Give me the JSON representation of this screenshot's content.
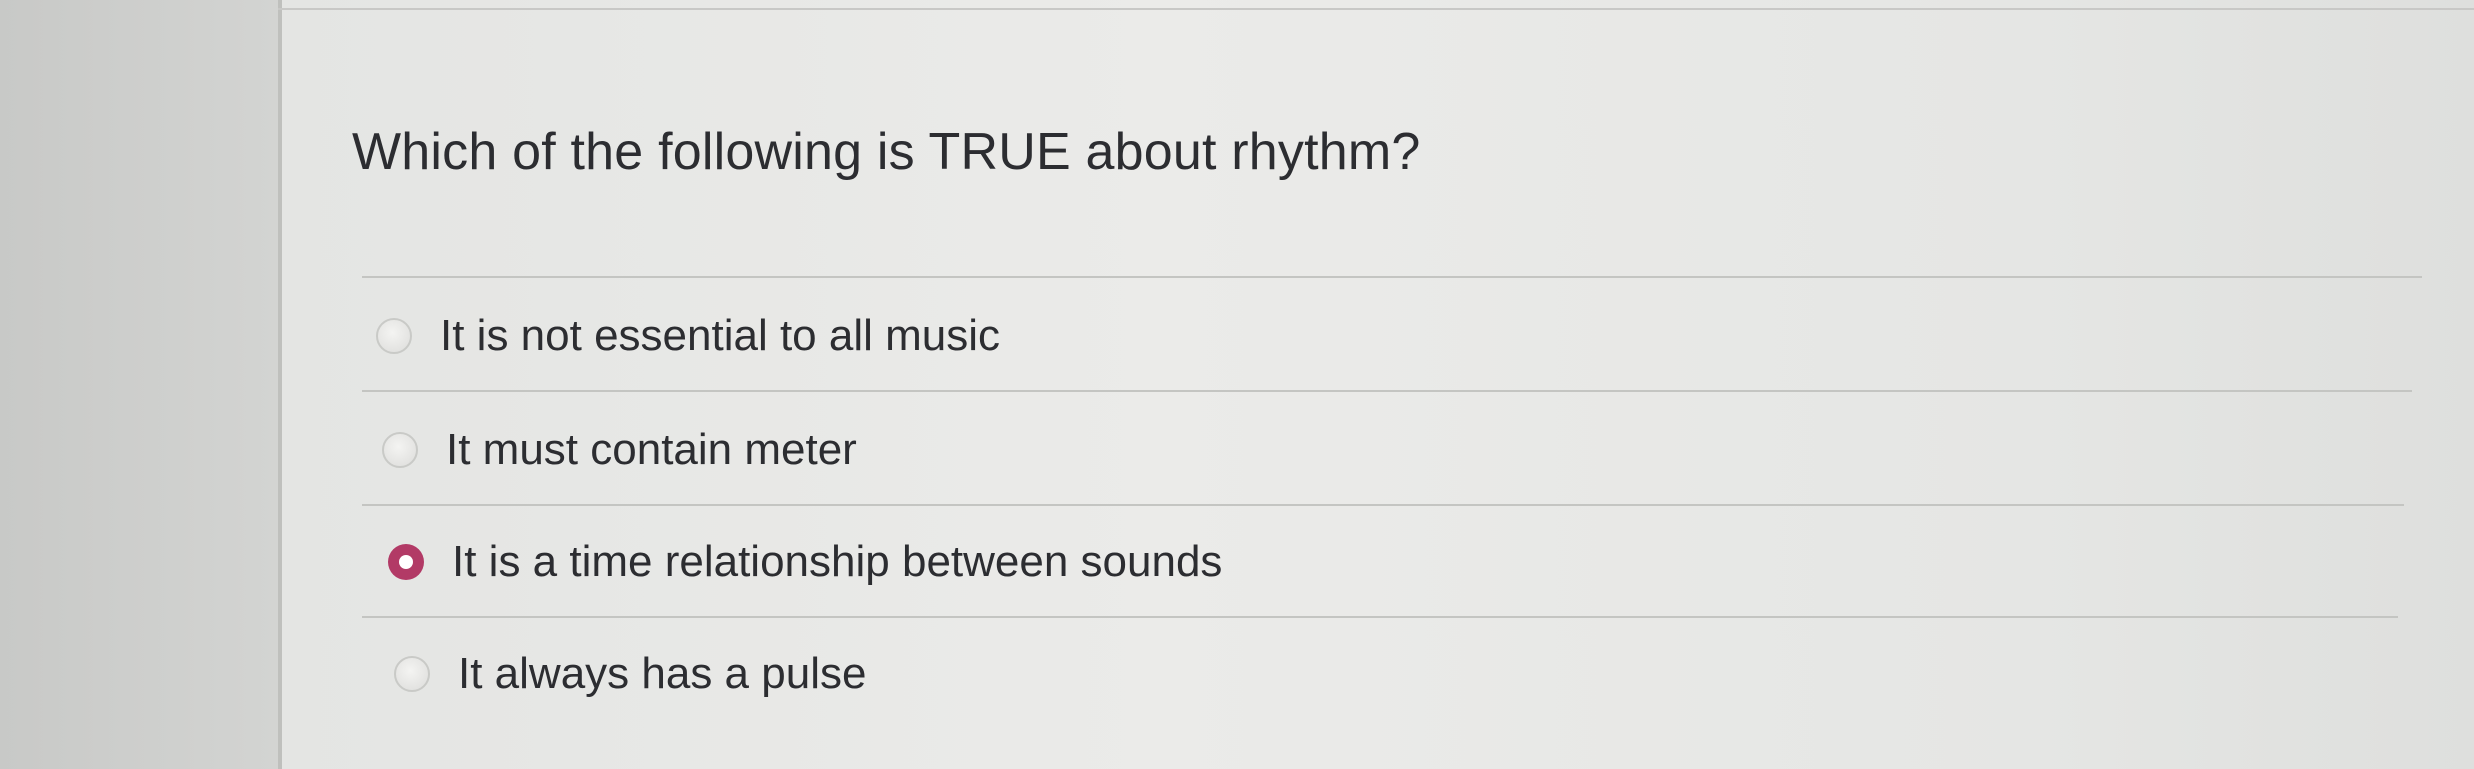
{
  "question": {
    "text": "Which of the following is TRUE about rhythm?"
  },
  "options": [
    {
      "label": "It is not essential to all music",
      "selected": false
    },
    {
      "label": "It must contain meter",
      "selected": false
    },
    {
      "label": "It is a time relationship between sounds",
      "selected": true
    },
    {
      "label": "It always has a pulse",
      "selected": false
    }
  ],
  "colors": {
    "selected_radio": "#b23a66",
    "text": "#2c2d31"
  }
}
